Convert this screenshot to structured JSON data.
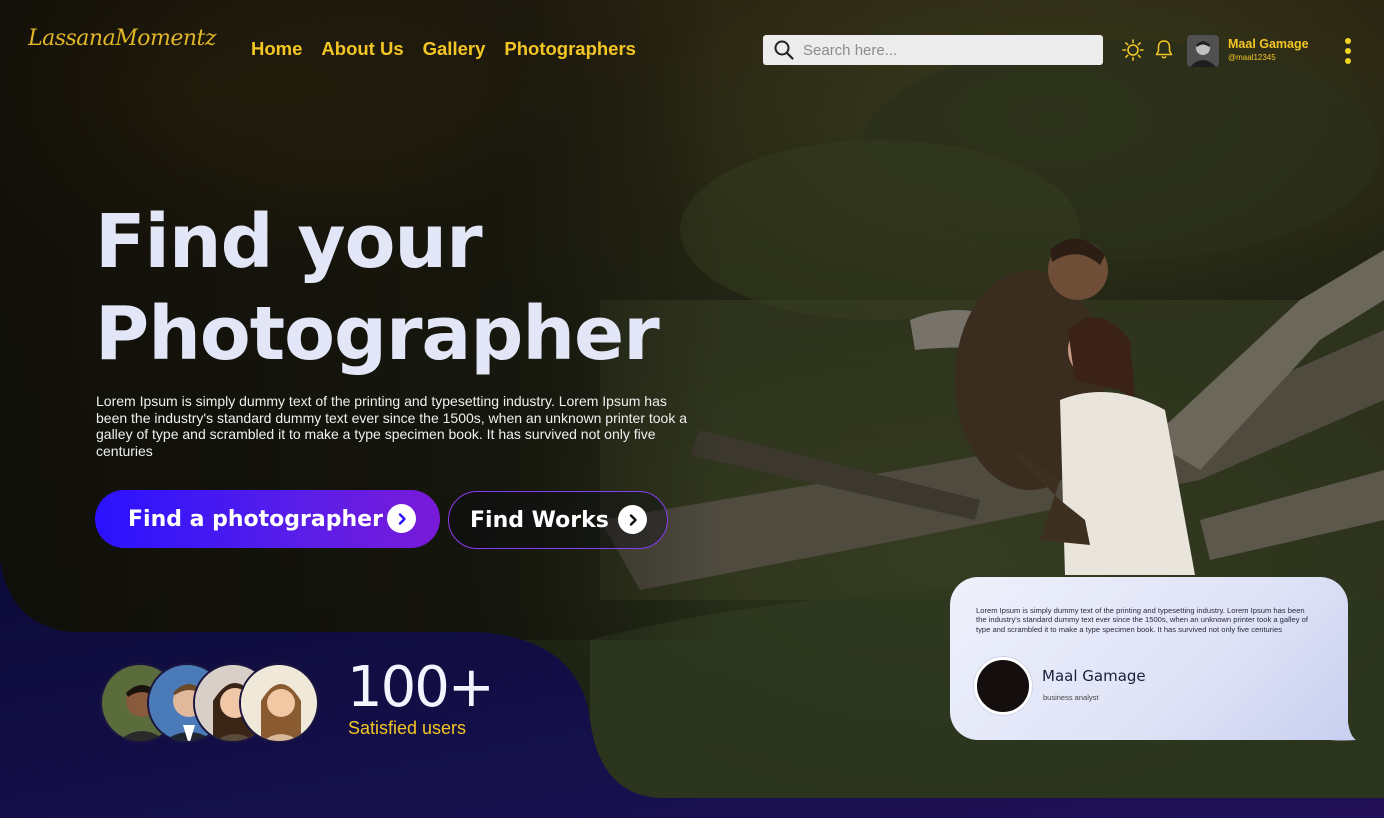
{
  "header": {
    "logo_text": "LassanaMomentz",
    "nav": [
      {
        "label": "Home"
      },
      {
        "label": "About Us"
      },
      {
        "label": "Gallery"
      },
      {
        "label": "Photographers"
      }
    ],
    "search": {
      "placeholder": "Search here...",
      "value": ""
    },
    "icons": [
      "sun-icon",
      "bell-icon"
    ],
    "user": {
      "name": "Maal Gamage",
      "handle": "@maal12345"
    }
  },
  "hero": {
    "title_line1": "Find your",
    "title_line2": "Photographer",
    "description": "Lorem Ipsum is simply dummy text of the printing and typesetting industry. Lorem Ipsum has been the industry's standard dummy text ever since the 1500s, when an unknown printer took a galley of type and scrambled it to make a type specimen book. It has survived not only five centuries",
    "primary_button": "Find a photographer",
    "secondary_button": "Find Works"
  },
  "stats": {
    "count": "100+",
    "label": "Satisfied users"
  },
  "testimonial": {
    "text": "Lorem Ipsum is simply dummy text of the printing and typesetting industry. Lorem Ipsum has been the industry's standard dummy text ever since the 1500s, when an unknown printer took a galley of type and scrambled it to make a type specimen book. It has survived not only five centuries",
    "name": "Maal Gamage",
    "role": "business analyst"
  },
  "colors": {
    "accent_yellow": "#f3c624",
    "primary_gradient_start": "#2a12ff",
    "primary_gradient_end": "#7a1ad8",
    "hero_text": "#e2e6f6",
    "bottom_panel": "#130f45"
  }
}
